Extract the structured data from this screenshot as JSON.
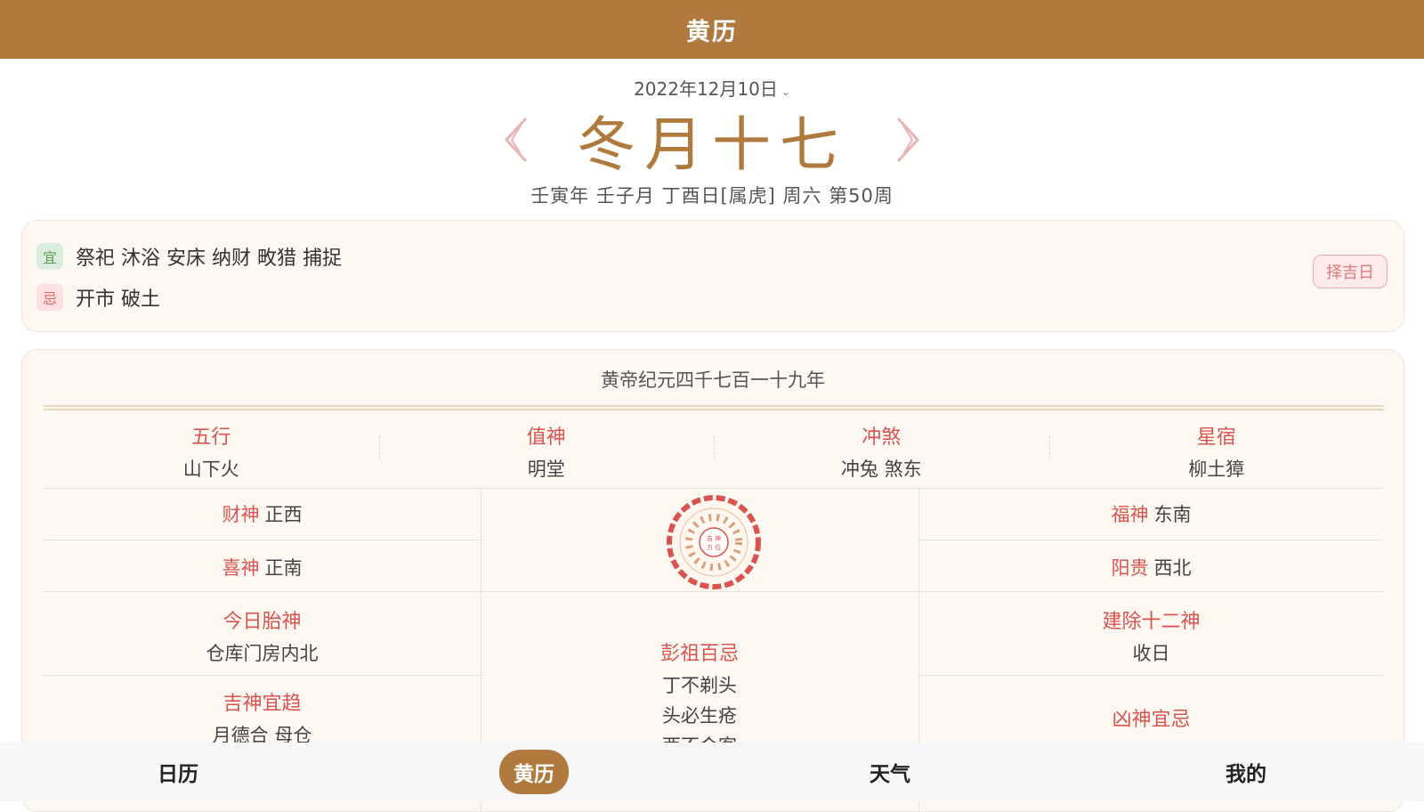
{
  "header": {
    "title": "黄历"
  },
  "date_selector": {
    "value": "2022年12月10日"
  },
  "lunar": {
    "date": "冬月十七",
    "ganzhi": "壬寅年 壬子月 丁酉日[属虎] 周六 第50周"
  },
  "yiji": {
    "yi_tag": "宜",
    "yi_text": "祭祀 沐浴 安床 纳财 畋猎 捕捉",
    "ji_tag": "忌",
    "ji_text": "开市 破土",
    "button": "择吉日"
  },
  "info": {
    "era": "黄帝纪元四千七百一十九年",
    "top": [
      {
        "label": "五行",
        "value": "山下火"
      },
      {
        "label": "值神",
        "value": "明堂"
      },
      {
        "label": "冲煞",
        "value": "冲兔 煞东"
      },
      {
        "label": "星宿",
        "value": "柳土獐"
      }
    ],
    "caishen": {
      "label": "财神",
      "value": "正西"
    },
    "xishen": {
      "label": "喜神",
      "value": "正南"
    },
    "fushen": {
      "label": "福神",
      "value": "东南"
    },
    "yanggui": {
      "label": "阳贵",
      "value": "西北"
    },
    "taishen": {
      "label": "今日胎神",
      "value": "仓库门房内北"
    },
    "jianchu": {
      "label": "建除十二神",
      "value": "收日"
    },
    "pengzu": {
      "label": "彭祖百忌",
      "line1": "丁不剃头",
      "line2": "头必生疮",
      "line3": "酉不会客"
    },
    "jishen": {
      "label": "吉神宜趋",
      "value": "月德合 母仓"
    },
    "xiongshen": {
      "label": "凶神宜忌"
    }
  },
  "nav": {
    "items": [
      "日历",
      "黄历",
      "天气",
      "我的"
    ],
    "active": 1
  },
  "colors": {
    "brand": "#b07a3e",
    "red_label": "#d9534f",
    "card_bg": "#fdf9f2"
  }
}
